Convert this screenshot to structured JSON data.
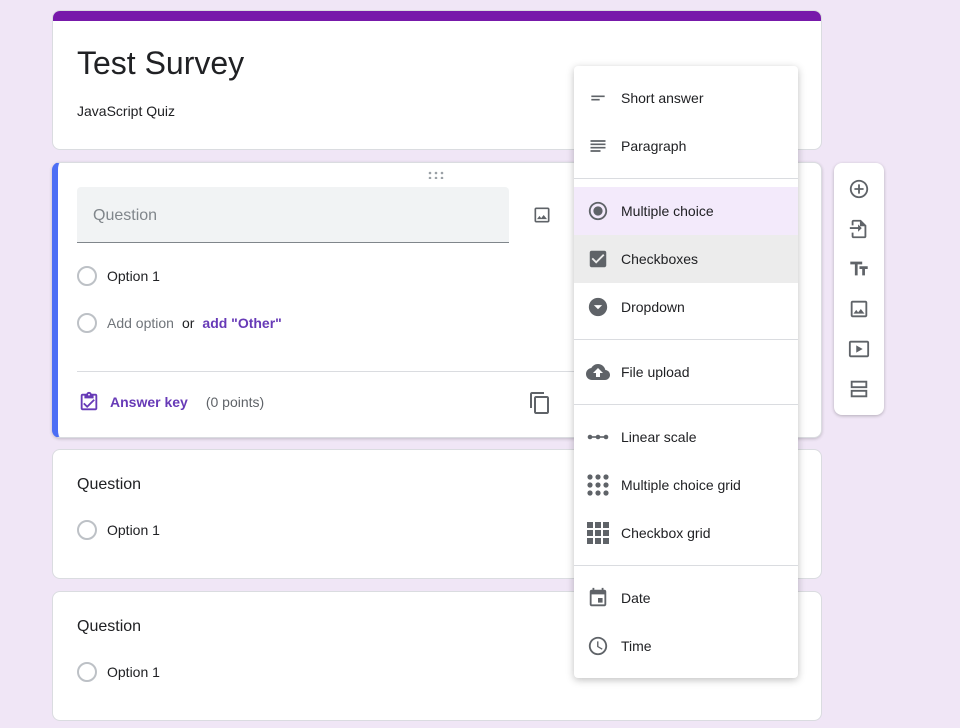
{
  "form": {
    "title": "Test Survey",
    "description": "JavaScript Quiz",
    "accent_color": "#7719aa"
  },
  "active_question": {
    "placeholder": "Question",
    "option1": "Option 1",
    "add_option": "Add option",
    "or": "or",
    "add_other": "add \"Other\"",
    "answer_key": "Answer key",
    "points": "(0 points)"
  },
  "questions": [
    {
      "title": "Question",
      "option": "Option 1"
    },
    {
      "title": "Question",
      "option": "Option 1"
    }
  ],
  "menu": {
    "items": [
      {
        "label": "Short answer",
        "icon": "short-answer-icon"
      },
      {
        "label": "Paragraph",
        "icon": "paragraph-icon"
      },
      {
        "label": "Multiple choice",
        "icon": "radio-button-icon"
      },
      {
        "label": "Checkboxes",
        "icon": "checkbox-icon"
      },
      {
        "label": "Dropdown",
        "icon": "dropdown-icon"
      },
      {
        "label": "File upload",
        "icon": "cloud-upload-icon"
      },
      {
        "label": "Linear scale",
        "icon": "linear-scale-icon"
      },
      {
        "label": "Multiple choice grid",
        "icon": "dot-grid-icon"
      },
      {
        "label": "Checkbox grid",
        "icon": "square-grid-icon"
      },
      {
        "label": "Date",
        "icon": "calendar-icon"
      },
      {
        "label": "Time",
        "icon": "clock-icon"
      }
    ],
    "selected": "Multiple choice"
  },
  "toolbar": {
    "icons": [
      "add-question-icon",
      "import-questions-icon",
      "add-title-icon",
      "add-image-icon",
      "add-video-icon",
      "add-section-icon"
    ]
  }
}
